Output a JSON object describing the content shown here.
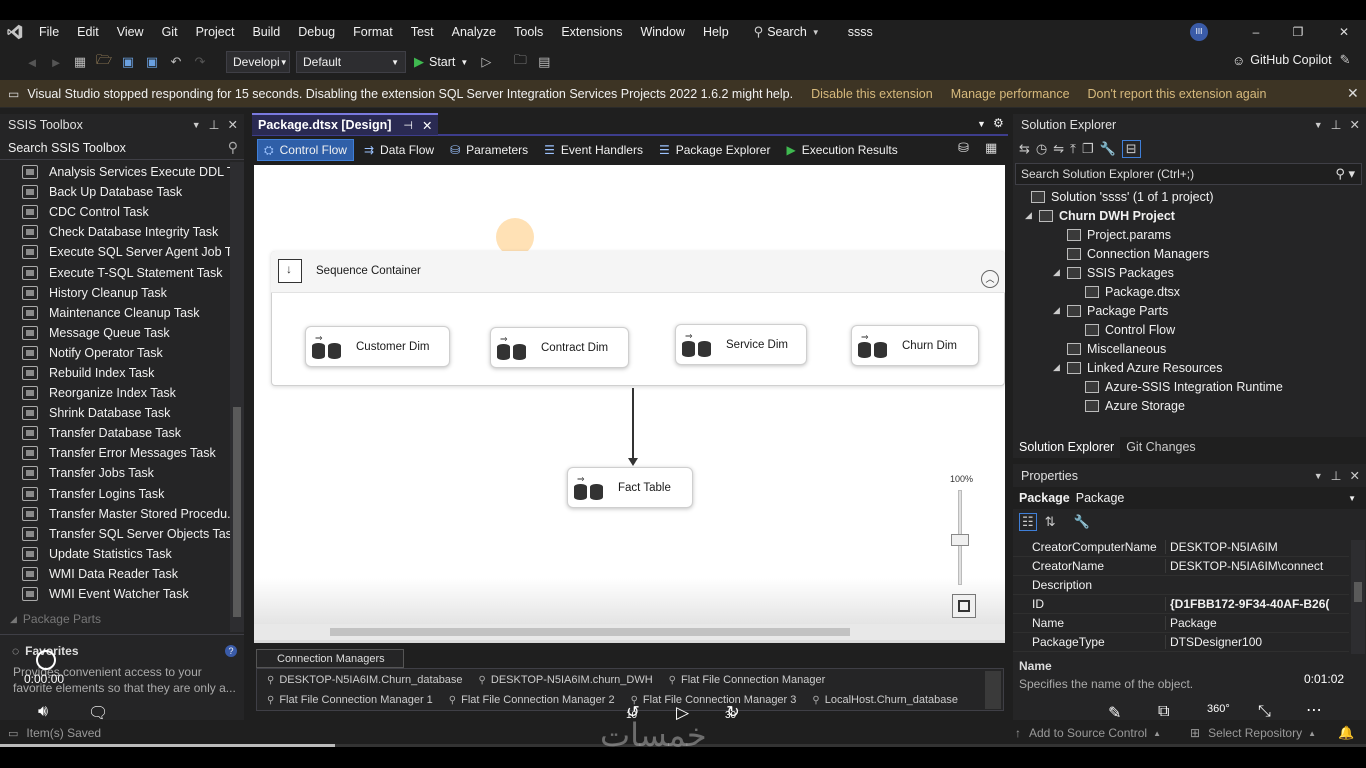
{
  "menu": {
    "items": [
      "File",
      "Edit",
      "View",
      "Git",
      "Project",
      "Build",
      "Debug",
      "Format",
      "Test",
      "Analyze",
      "Tools",
      "Extensions",
      "Window",
      "Help"
    ],
    "search_label": "Search",
    "solution_name": "ssss"
  },
  "toolbar": {
    "config_combo": "Developi",
    "platform_combo": "Default",
    "start_label": "Start",
    "copilot_label": "GitHub Copilot"
  },
  "infobar": {
    "message": "Visual Studio stopped responding for 15 seconds. Disabling the extension SQL Server Integration Services Projects 2022 1.6.2 might help.",
    "link_disable": "Disable this extension",
    "link_manage": "Manage performance",
    "link_dont_report": "Don't report this extension again"
  },
  "toolbox": {
    "title": "SSIS Toolbox",
    "search_placeholder": "Search SSIS Toolbox",
    "items": [
      "Analysis Services Execute DDL T...",
      "Back Up Database Task",
      "CDC Control Task",
      "Check Database Integrity Task",
      "Execute SQL Server Agent Job T...",
      "Execute T-SQL Statement Task",
      "History Cleanup Task",
      "Maintenance Cleanup Task",
      "Message Queue Task",
      "Notify Operator Task",
      "Rebuild Index Task",
      "Reorganize Index Task",
      "Shrink Database Task",
      "Transfer Database Task",
      "Transfer Error Messages Task",
      "Transfer Jobs Task",
      "Transfer Logins Task",
      "Transfer Master Stored Procedu...",
      "Transfer SQL Server Objects Task",
      "Update Statistics Task",
      "WMI Data Reader Task",
      "WMI Event Watcher Task"
    ],
    "package_parts": "Package Parts",
    "favorites_title": "Favorites",
    "favorites_desc": "Provides convenient access to your favorite elements so that they are only a..."
  },
  "document": {
    "tab_title": "Package.dtsx [Design]",
    "design_tabs": [
      "Control Flow",
      "Data Flow",
      "Parameters",
      "Event Handlers",
      "Package Explorer",
      "Execution Results"
    ],
    "sequence_container": "Sequence Container",
    "tasks": [
      "Customer Dim",
      "Contract Dim",
      "Service Dim",
      "Churn Dim"
    ],
    "fact_task": "Fact Table",
    "zoom": "100%",
    "conn_tab": "Connection Managers",
    "connections_row1": [
      "DESKTOP-N5IA6IM.Churn_database",
      "DESKTOP-N5IA6IM.churn_DWH",
      "Flat File Connection Manager"
    ],
    "connections_row2": [
      "Flat File Connection Manager 1",
      "Flat File Connection Manager 2",
      "Flat File Connection Manager 3",
      "LocalHost.Churn_database"
    ]
  },
  "solution_explorer": {
    "title": "Solution Explorer",
    "search_placeholder": "Search Solution Explorer (Ctrl+;)",
    "solution_label": "Solution 'ssss' (1 of 1 project)",
    "project": "Churn DWH Project",
    "project_params": "Project.params",
    "connection_managers": "Connection Managers",
    "ssis_packages": "SSIS Packages",
    "package_file": "Package.dtsx",
    "package_parts": "Package Parts",
    "control_flow": "Control Flow",
    "miscellaneous": "Miscellaneous",
    "linked_azure": "Linked Azure Resources",
    "azure_ir": "Azure-SSIS Integration Runtime",
    "azure_storage": "Azure Storage",
    "tab_solution": "Solution Explorer",
    "tab_git": "Git Changes"
  },
  "properties": {
    "title": "Properties",
    "object_name": "Package",
    "object_type": "Package",
    "rows": [
      {
        "name": "CreatorComputerName",
        "value": "DESKTOP-N5IA6IM"
      },
      {
        "name": "CreatorName",
        "value": "DESKTOP-N5IA6IM\\connect"
      },
      {
        "name": "Description",
        "value": ""
      },
      {
        "name": "ID",
        "value": "{D1FBB172-9F34-40AF-B26("
      },
      {
        "name": "Name",
        "value": "Package"
      },
      {
        "name": "PackageType",
        "value": "DTSDesigner100"
      }
    ],
    "desc_title": "Name",
    "desc_text": "Specifies the name of the object."
  },
  "player": {
    "time_current": "0:00:00",
    "time_total": "0:01:02",
    "skip_back": "10",
    "skip_forward": "30",
    "progress": 0.245,
    "watermark": "خمسات"
  },
  "status": {
    "items_saved": "Item(s) Saved",
    "add_source": "Add to Source Control",
    "select_repo": "Select Repository"
  },
  "colors": {
    "accent": "#2f5fa8",
    "infobar": "#3d3424",
    "link": "#d7ba7d"
  }
}
